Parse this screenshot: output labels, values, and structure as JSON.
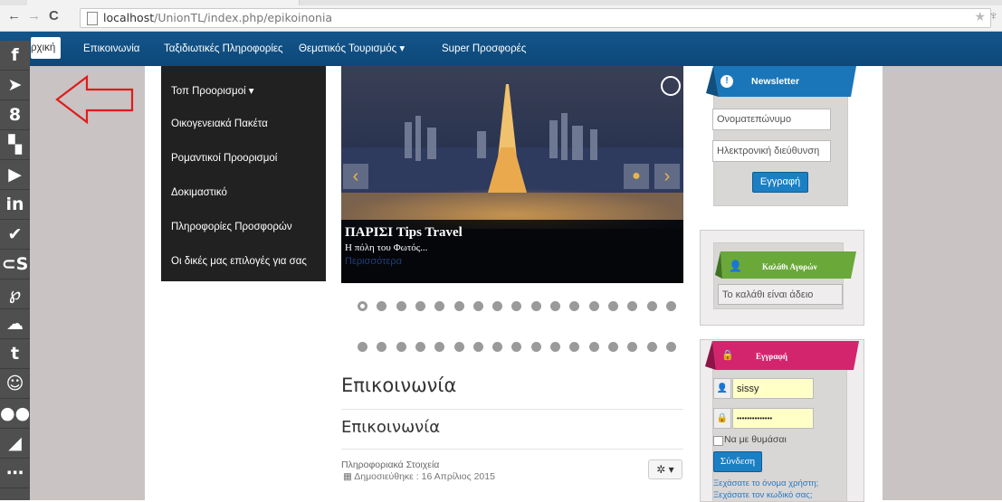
{
  "browser": {
    "back": "←",
    "forward": "→",
    "reload": "C",
    "url_host": "localhost",
    "url_path": "/UnionTL/index.php/epikoinonia"
  },
  "topnav": {
    "items": [
      {
        "label": "ρχική"
      },
      {
        "label": "Επικοινωνία"
      },
      {
        "label": "Ταξιδιωτικές Πληροφορίες"
      },
      {
        "label": "Θεματικός Τουρισμός ▾"
      },
      {
        "label": "Super Προσφορές"
      }
    ]
  },
  "social": {
    "icons": [
      "facebook-icon",
      "twitter-icon",
      "google-plus-icon",
      "flickr-icon",
      "youtube-icon",
      "linkedin-icon",
      "delicious-icon",
      "lastfm-icon",
      "pinterest-icon",
      "soundcloud-icon",
      "tumblr-icon",
      "github-icon",
      "flickr-dots-icon",
      "rss-icon",
      "more-icon"
    ],
    "glyphs": [
      "f",
      "➤",
      "8",
      "▚",
      "▶",
      "in",
      "✔",
      "⊂S",
      "℘",
      "☁",
      "t",
      "☺",
      "●●",
      "◢",
      "⋯"
    ]
  },
  "dropdown": {
    "items": [
      {
        "label": "Τοπ Προορισμοί ▾"
      },
      {
        "label": "Οικογενειακά Πακέτα"
      },
      {
        "label": "Ρομαντικοί Προορισμοί"
      },
      {
        "label": "Δοκιμαστικό"
      },
      {
        "label": "Πληροφορίες Προσφορών"
      },
      {
        "label": "Οι δικές μας επιλογές για σας"
      }
    ]
  },
  "slider": {
    "caption_title": "ΠΑΡΙΣΙ Tips Travel",
    "caption_text": "Η πόλη του Φωτός...",
    "caption_link": "Περισσότερα"
  },
  "article": {
    "page_heading": "Επικοινωνία",
    "sub_heading": "Επικοινωνία",
    "category": "Πληροφοριακά Στοιχεία",
    "published": "Δημοσιεύθηκε : 16 Απρίλιος 2015"
  },
  "newsletter": {
    "title": "Newsletter",
    "name_placeholder": "Ονοματεπώνυμο",
    "email_placeholder": "Ηλεκτρονική διεύθυνση",
    "submit": "Εγγραφή"
  },
  "cart": {
    "title": "Καλάθι Αγορών",
    "empty_text": "Το καλάθι είναι άδειο"
  },
  "login": {
    "title": "Εγγραφή",
    "username": "sissy",
    "password": "••••••••••••••",
    "remember": "Να με θυμάσαι",
    "submit": "Σύνδεση",
    "forgot_user": "Ξεχάσατε το όνομα χρήστη;",
    "forgot_pass": "Ξεχάσατε τον κωδικό σας;"
  },
  "colors": {
    "nav_blue": "#14558a",
    "social_gray": "#4f4f4f",
    "side_gray": "#c9c3c3",
    "annotation_red": "#e01b1b"
  }
}
